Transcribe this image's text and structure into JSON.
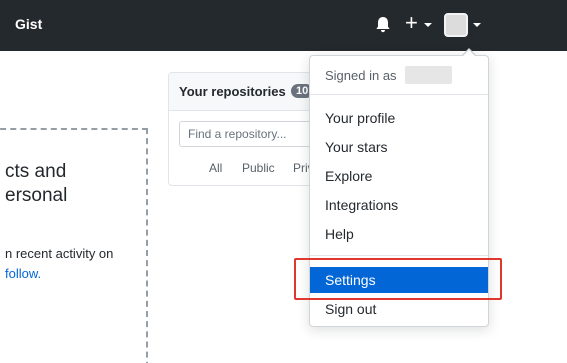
{
  "header": {
    "logo_text": "Gist",
    "icons": [
      "bell-icon",
      "plus-icon",
      "avatar"
    ]
  },
  "onboarding": {
    "heading_line1": "cts and",
    "heading_line2": "ersonal",
    "body_line1": "n recent activity on",
    "body_line2": "follow."
  },
  "repositories": {
    "title": "Your repositories",
    "count": "10",
    "search_placeholder": "Find a repository...",
    "filters": {
      "all": "All",
      "public": "Public",
      "private": "Priv"
    }
  },
  "dropdown": {
    "signed_in_label": "Signed in as",
    "items": [
      {
        "label": "Your profile"
      },
      {
        "label": "Your stars"
      },
      {
        "label": "Explore"
      },
      {
        "label": "Integrations"
      },
      {
        "label": "Help"
      },
      {
        "label": "Settings"
      },
      {
        "label": "Sign out"
      }
    ],
    "active_item": "Settings",
    "colors": {
      "active_bg": "#0366d6",
      "highlight_border": "#e0362c"
    }
  },
  "colors": {
    "header_bg": "#24292e",
    "link": "#0366d6"
  }
}
